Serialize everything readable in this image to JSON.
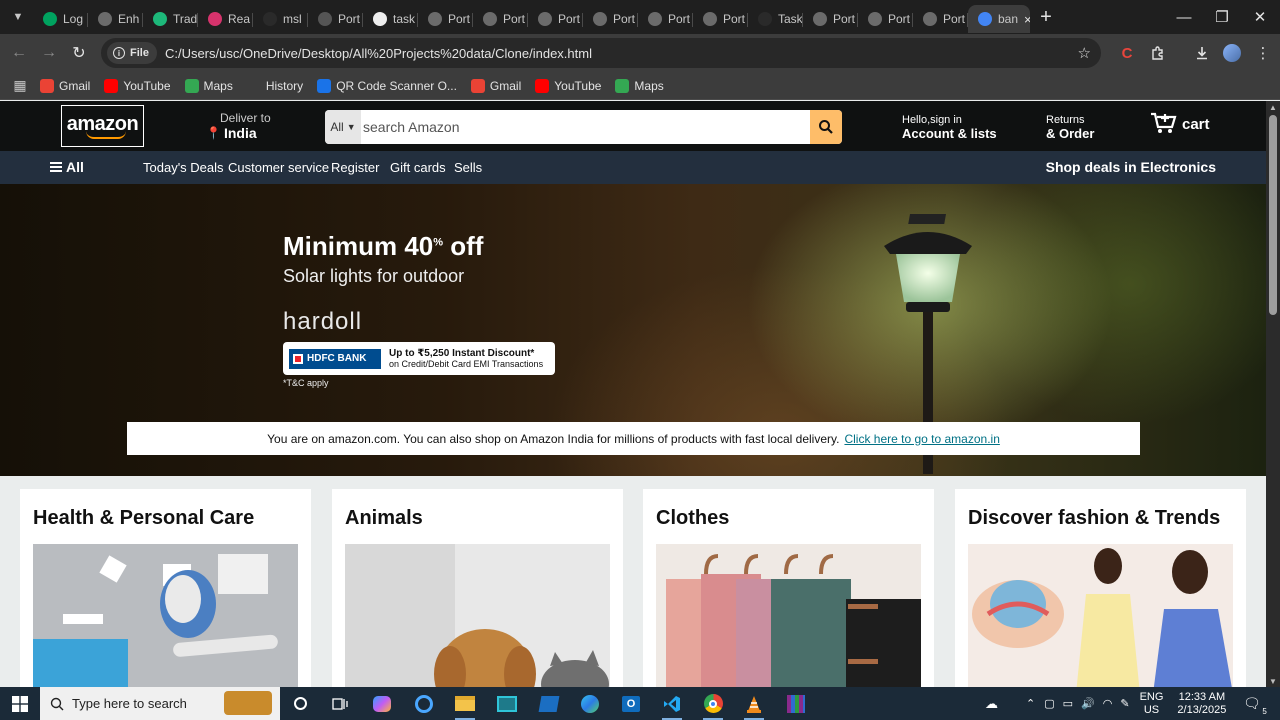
{
  "browser": {
    "tabs": [
      {
        "label": "Log",
        "color": "#00a25f"
      },
      {
        "label": "Enh",
        "color": "#6b6b6b"
      },
      {
        "label": "Trad",
        "color": "#1db87a"
      },
      {
        "label": "Rea",
        "color": "#d6336c"
      },
      {
        "label": "msl",
        "color": "#2a2a2a"
      },
      {
        "label": "Port",
        "color": "#555555"
      },
      {
        "label": "task",
        "color": "#eeeeee"
      },
      {
        "label": "Port",
        "color": "#6b6b6b"
      },
      {
        "label": "Port",
        "color": "#6b6b6b"
      },
      {
        "label": "Port",
        "color": "#6b6b6b"
      },
      {
        "label": "Port",
        "color": "#6b6b6b"
      },
      {
        "label": "Port",
        "color": "#6b6b6b"
      },
      {
        "label": "Port",
        "color": "#6b6b6b"
      },
      {
        "label": "Task",
        "color": "#2a2a2a"
      },
      {
        "label": "Port",
        "color": "#6b6b6b"
      },
      {
        "label": "Port",
        "color": "#6b6b6b"
      },
      {
        "label": "Port",
        "color": "#6b6b6b"
      },
      {
        "label": "ban",
        "color": "#4285f4"
      }
    ],
    "active_tab_close": "×",
    "new_tab": "+",
    "address": {
      "chip": "File",
      "url": "C:/Users/usc/OneDrive/Desktop/All%20Projects%20data/Clone/index.html"
    },
    "bookmarks": [
      {
        "label": "Gmail",
        "icon": "gmail-icon",
        "color": "#ea4335"
      },
      {
        "label": "YouTube",
        "icon": "youtube-icon",
        "color": "#ff0000"
      },
      {
        "label": "Maps",
        "icon": "maps-icon",
        "color": "#34a853"
      },
      {
        "label": "History",
        "icon": "history-icon",
        "color": "#3c3c3c"
      },
      {
        "label": "QR Code Scanner O...",
        "icon": "qr-icon",
        "color": "#1a73e8"
      },
      {
        "label": "Gmail",
        "icon": "gmail-icon",
        "color": "#ea4335"
      },
      {
        "label": "YouTube",
        "icon": "youtube-icon",
        "color": "#ff0000"
      },
      {
        "label": "Maps",
        "icon": "maps-icon",
        "color": "#34a853"
      }
    ]
  },
  "amazon": {
    "logo": "amazon",
    "deliver_line1": "Deliver to",
    "deliver_line2": "India",
    "search_category": "All",
    "search_placeholder": "search Amazon",
    "account_line1": "Hello,sign in",
    "account_line2": "Account & lists",
    "returns_line1": "Returns",
    "returns_line2": "& Order",
    "cart_label": "cart",
    "nav_all": "All",
    "nav_links": [
      "Today's Deals",
      "Customer service",
      "Register",
      "Gift cards",
      "Sells"
    ],
    "nav_deals": "Shop deals in Electronics",
    "hero": {
      "title_main": "Minimum 40",
      "title_sup": "%",
      "title_end": " off",
      "subtitle": "Solar lights for outdoor",
      "brand": "hardoll",
      "bank": "HDFC BANK",
      "offer_line1": "Up to ₹5,250 Instant Discount*",
      "offer_line2": "on Credit/Debit Card EMI Transactions",
      "tc": "*T&C apply"
    },
    "notice_text": "You are on amazon.com. You can also shop on Amazon India for millions of products with fast local delivery.",
    "notice_link": "Click here to go to amazon.in",
    "cards": [
      {
        "title": "Health & Personal Care"
      },
      {
        "title": "Animals"
      },
      {
        "title": "Clothes"
      },
      {
        "title": "Discover fashion & Trends"
      }
    ]
  },
  "taskbar": {
    "search_placeholder": "Type here to search",
    "lang1": "ENG",
    "lang2": "US",
    "time": "12:33 AM",
    "date": "2/13/2025",
    "notif_count": "5"
  }
}
